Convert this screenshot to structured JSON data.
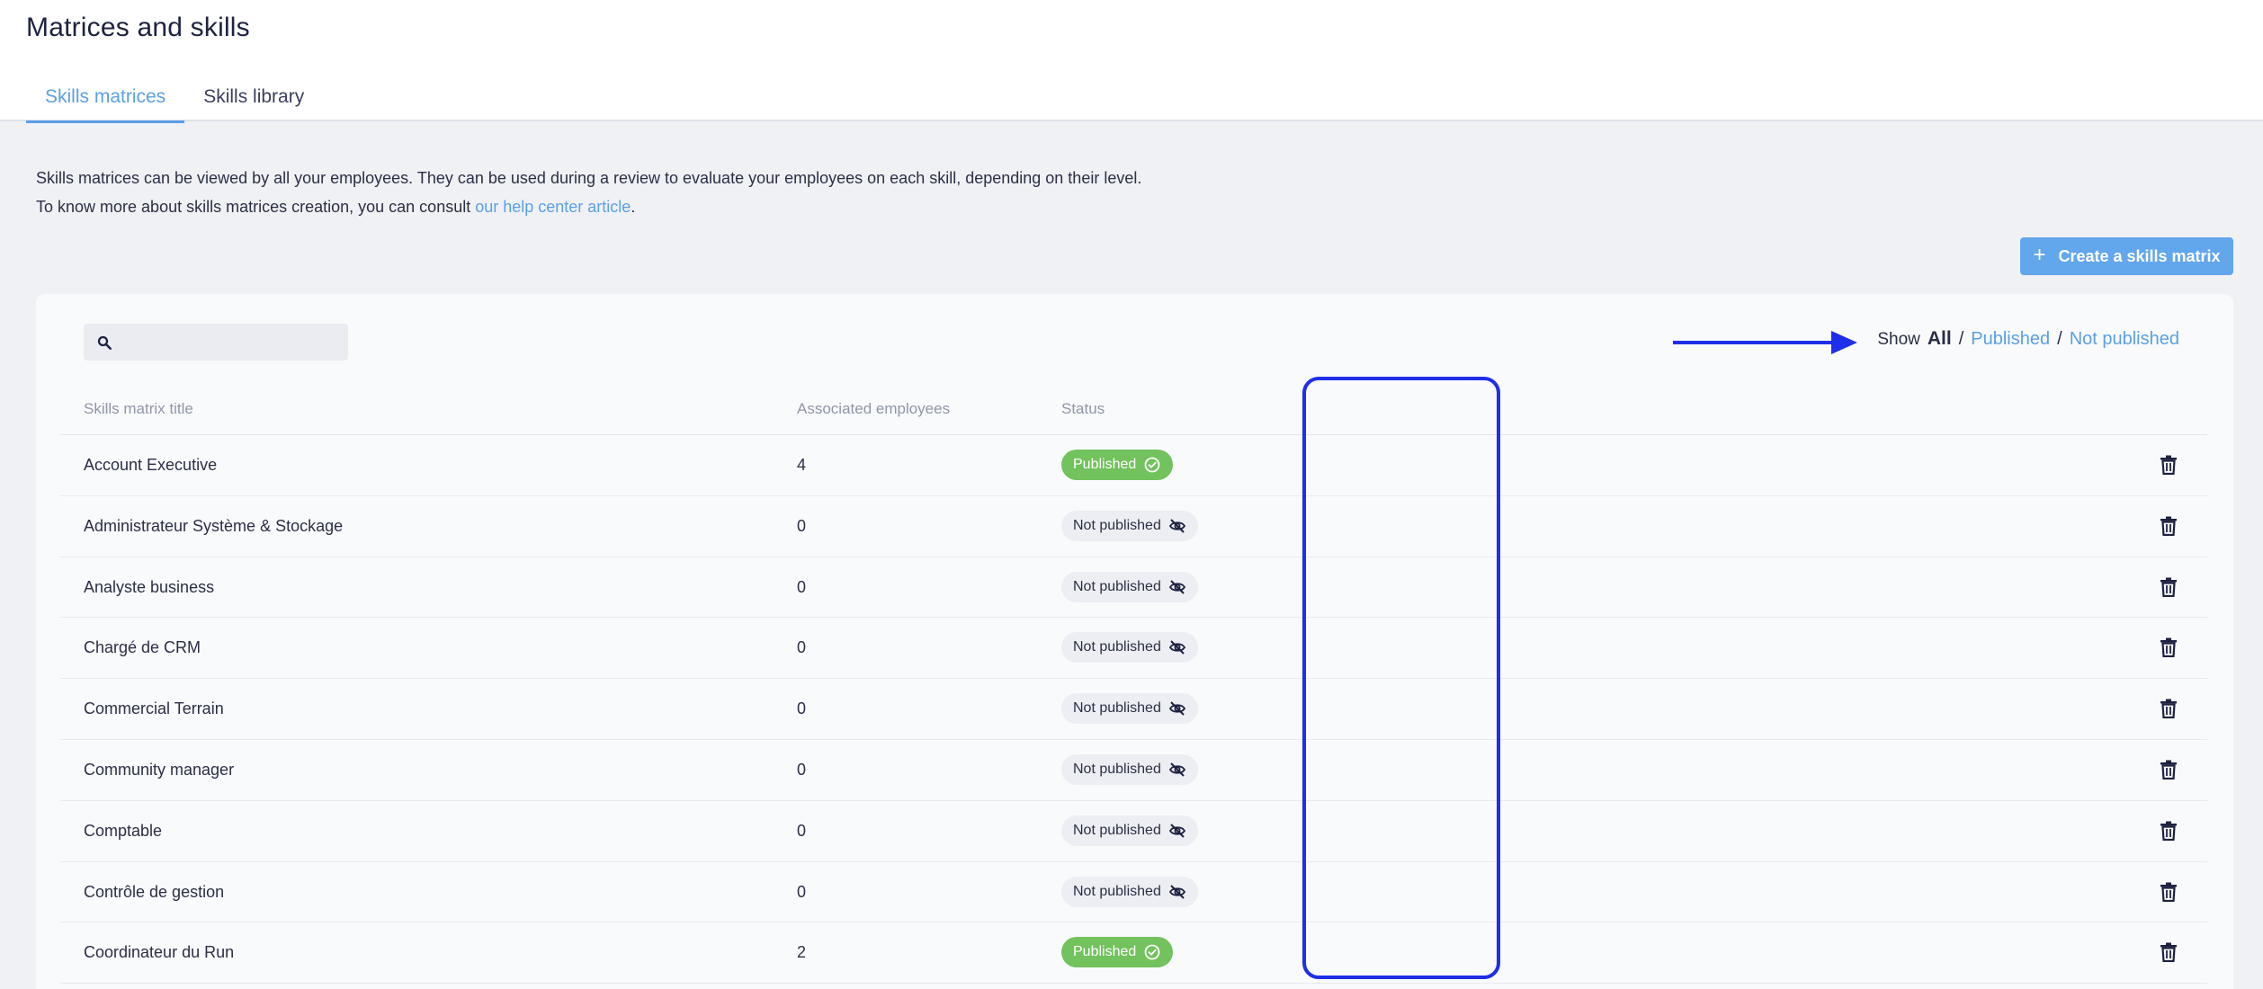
{
  "header": {
    "title": "Matrices and skills",
    "tabs": [
      {
        "label": "Skills matrices",
        "active": true
      },
      {
        "label": "Skills library",
        "active": false
      }
    ]
  },
  "intro": {
    "line1": "Skills matrices can be viewed by all your employees. They can be used during a review to evaluate your employees on each skill, depending on their level.",
    "line2_prefix": "To know more about skills matrices creation, you can consult ",
    "line2_link": "our help center article",
    "line2_suffix": "."
  },
  "toolbar": {
    "create_label": "Create a skills matrix",
    "create_icon": "plus-icon"
  },
  "search": {
    "placeholder": "",
    "value": "",
    "icon": "search-icon"
  },
  "filter": {
    "label": "Show",
    "options": [
      "All",
      "Published",
      "Not published"
    ],
    "selected": "All",
    "separator": "/"
  },
  "table": {
    "columns": [
      "Skills matrix title",
      "Associated employees",
      "Status"
    ],
    "rows": [
      {
        "title": "Account Executive",
        "employees": "4",
        "status": "Published"
      },
      {
        "title": "Administrateur Système & Stockage",
        "employees": "0",
        "status": "Not published"
      },
      {
        "title": "Analyste business",
        "employees": "0",
        "status": "Not published"
      },
      {
        "title": "Chargé de CRM",
        "employees": "0",
        "status": "Not published"
      },
      {
        "title": "Commercial Terrain",
        "employees": "0",
        "status": "Not published"
      },
      {
        "title": "Community manager",
        "employees": "0",
        "status": "Not published"
      },
      {
        "title": "Comptable",
        "employees": "0",
        "status": "Not published"
      },
      {
        "title": "Contrôle de gestion",
        "employees": "0",
        "status": "Not published"
      },
      {
        "title": "Coordinateur du Run",
        "employees": "2",
        "status": "Published"
      }
    ]
  },
  "colors": {
    "accent": "#5aa0e6",
    "published": "#72c25d",
    "not_published_bg": "#eceef3",
    "annotation": "#1f2ee8"
  }
}
